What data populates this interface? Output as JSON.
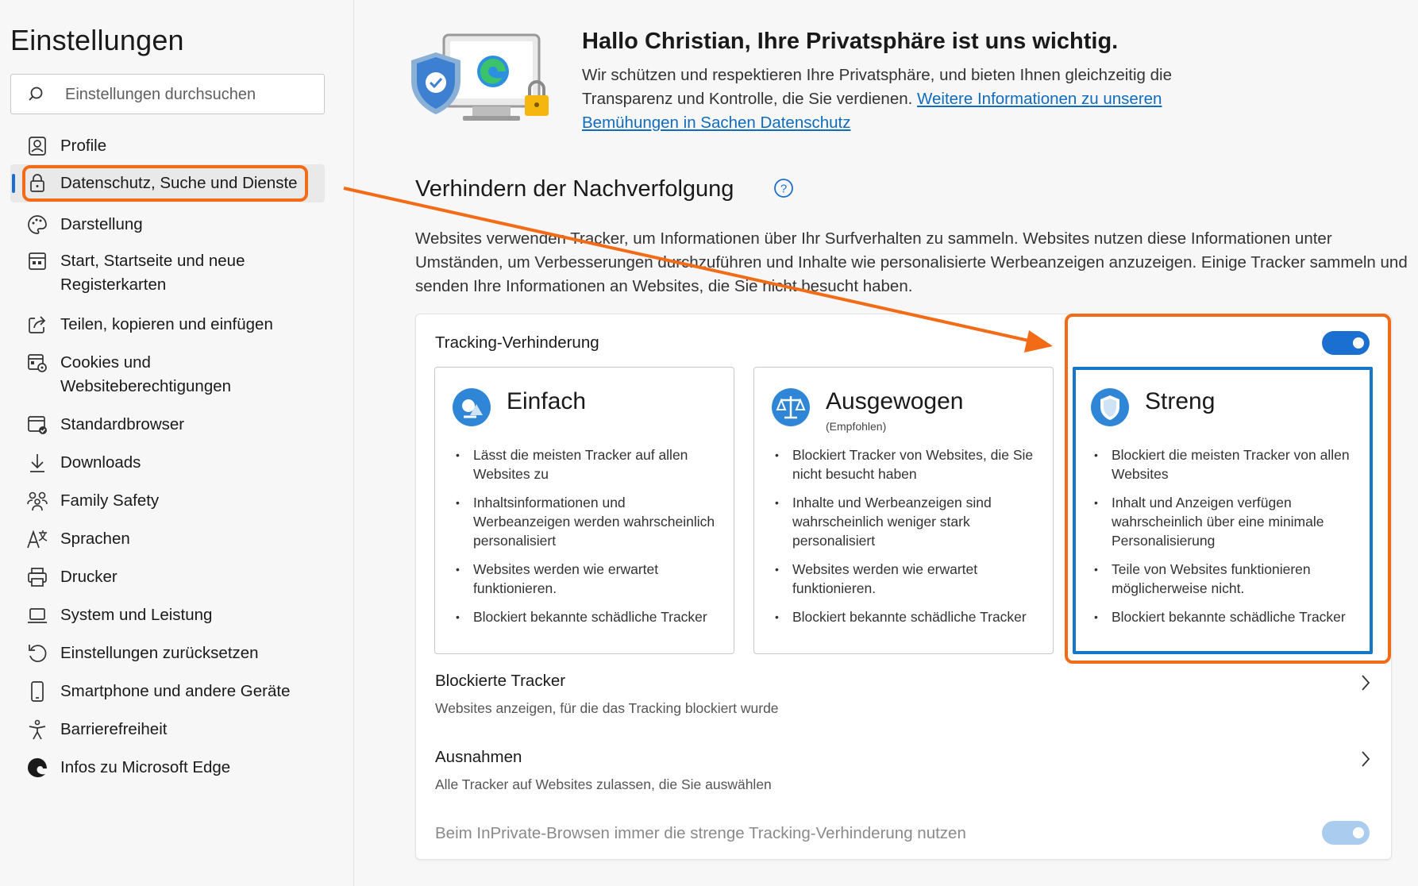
{
  "sidebar": {
    "title": "Einstellungen",
    "search_placeholder": "Einstellungen durchsuchen",
    "items": [
      {
        "label": "Profile",
        "icon": "profile-icon"
      },
      {
        "label": "Datenschutz, Suche und Dienste",
        "icon": "lock-icon",
        "active": true
      },
      {
        "label": "Darstellung",
        "icon": "palette-icon"
      },
      {
        "label": "Start, Startseite und neue Registerkarten",
        "icon": "home-tabs-icon"
      },
      {
        "label": "Teilen, kopieren und einfügen",
        "icon": "share-icon"
      },
      {
        "label": "Cookies und Websiteberechtigungen",
        "icon": "cookie-permissions-icon"
      },
      {
        "label": "Standardbrowser",
        "icon": "default-browser-icon"
      },
      {
        "label": "Downloads",
        "icon": "download-icon"
      },
      {
        "label": "Family Safety",
        "icon": "family-icon"
      },
      {
        "label": "Sprachen",
        "icon": "language-icon"
      },
      {
        "label": "Drucker",
        "icon": "printer-icon"
      },
      {
        "label": "System und Leistung",
        "icon": "laptop-icon"
      },
      {
        "label": "Einstellungen zurücksetzen",
        "icon": "reset-icon"
      },
      {
        "label": "Smartphone und andere Geräte",
        "icon": "phone-icon"
      },
      {
        "label": "Barrierefreiheit",
        "icon": "accessibility-icon"
      },
      {
        "label": "Infos zu Microsoft Edge",
        "icon": "edge-logo-icon"
      }
    ]
  },
  "hero": {
    "title": "Hallo Christian, Ihre Privatsphäre ist uns wichtig.",
    "text": "Wir schützen und respektieren Ihre Privatsphäre, und bieten Ihnen gleichzeitig die Transparenz und Kontrolle, die Sie verdienen. ",
    "link": "Weitere Informationen zu unseren Bemühungen in Sachen Datenschutz"
  },
  "tracking": {
    "title": "Verhindern der Nachverfolgung",
    "description": "Websites verwenden Tracker, um Informationen über Ihr Surfverhalten zu sammeln. Websites nutzen diese Informationen unter Umständen, um Verbesserungen durchzuführen und Inhalte wie personalisierte Werbeanzeigen anzuzeigen. Einige Tracker sammeln und senden Ihre Informationen an Websites, die Sie nicht besucht haben.",
    "card_label": "Tracking-Verhinderung",
    "enabled": true,
    "options": [
      {
        "name": "Einfach",
        "sub": "",
        "icon": "basic-shield-icon",
        "bullets": [
          "Lässt die meisten Tracker auf allen Websites zu",
          "Inhaltsinformationen und Werbeanzeigen werden wahrscheinlich personalisiert",
          "Websites werden wie erwartet funktionieren.",
          "Blockiert bekannte schädliche Tracker"
        ]
      },
      {
        "name": "Ausgewogen",
        "sub": "(Empfohlen)",
        "icon": "balance-scale-icon",
        "bullets": [
          "Blockiert Tracker von Websites, die Sie nicht besucht haben",
          "Inhalte und Werbeanzeigen sind wahrscheinlich weniger stark personalisiert",
          "Websites werden wie erwartet funktionieren.",
          "Blockiert bekannte schädliche Tracker"
        ]
      },
      {
        "name": "Streng",
        "sub": "",
        "icon": "strict-shield-icon",
        "selected": true,
        "bullets": [
          "Blockiert die meisten Tracker von allen Websites",
          "Inhalt und Anzeigen verfügen wahrscheinlich über eine minimale Personalisierung",
          "Teile von Websites funktionieren möglicherweise nicht.",
          "Blockiert bekannte schädliche Tracker"
        ]
      }
    ],
    "blocked_title": "Blockierte Tracker",
    "blocked_sub": "Websites anzeigen, für die das Tracking blockiert wurde",
    "exceptions_title": "Ausnahmen",
    "exceptions_sub": "Alle Tracker auf Websites zulassen, die Sie auswählen",
    "inprivate_label": "Beim InPrivate-Browsen immer die strenge Tracking-Verhinderung nutzen"
  },
  "colors": {
    "accent": "#1a6fd1",
    "highlight": "#f26b16",
    "selected_border": "#1577c8"
  }
}
